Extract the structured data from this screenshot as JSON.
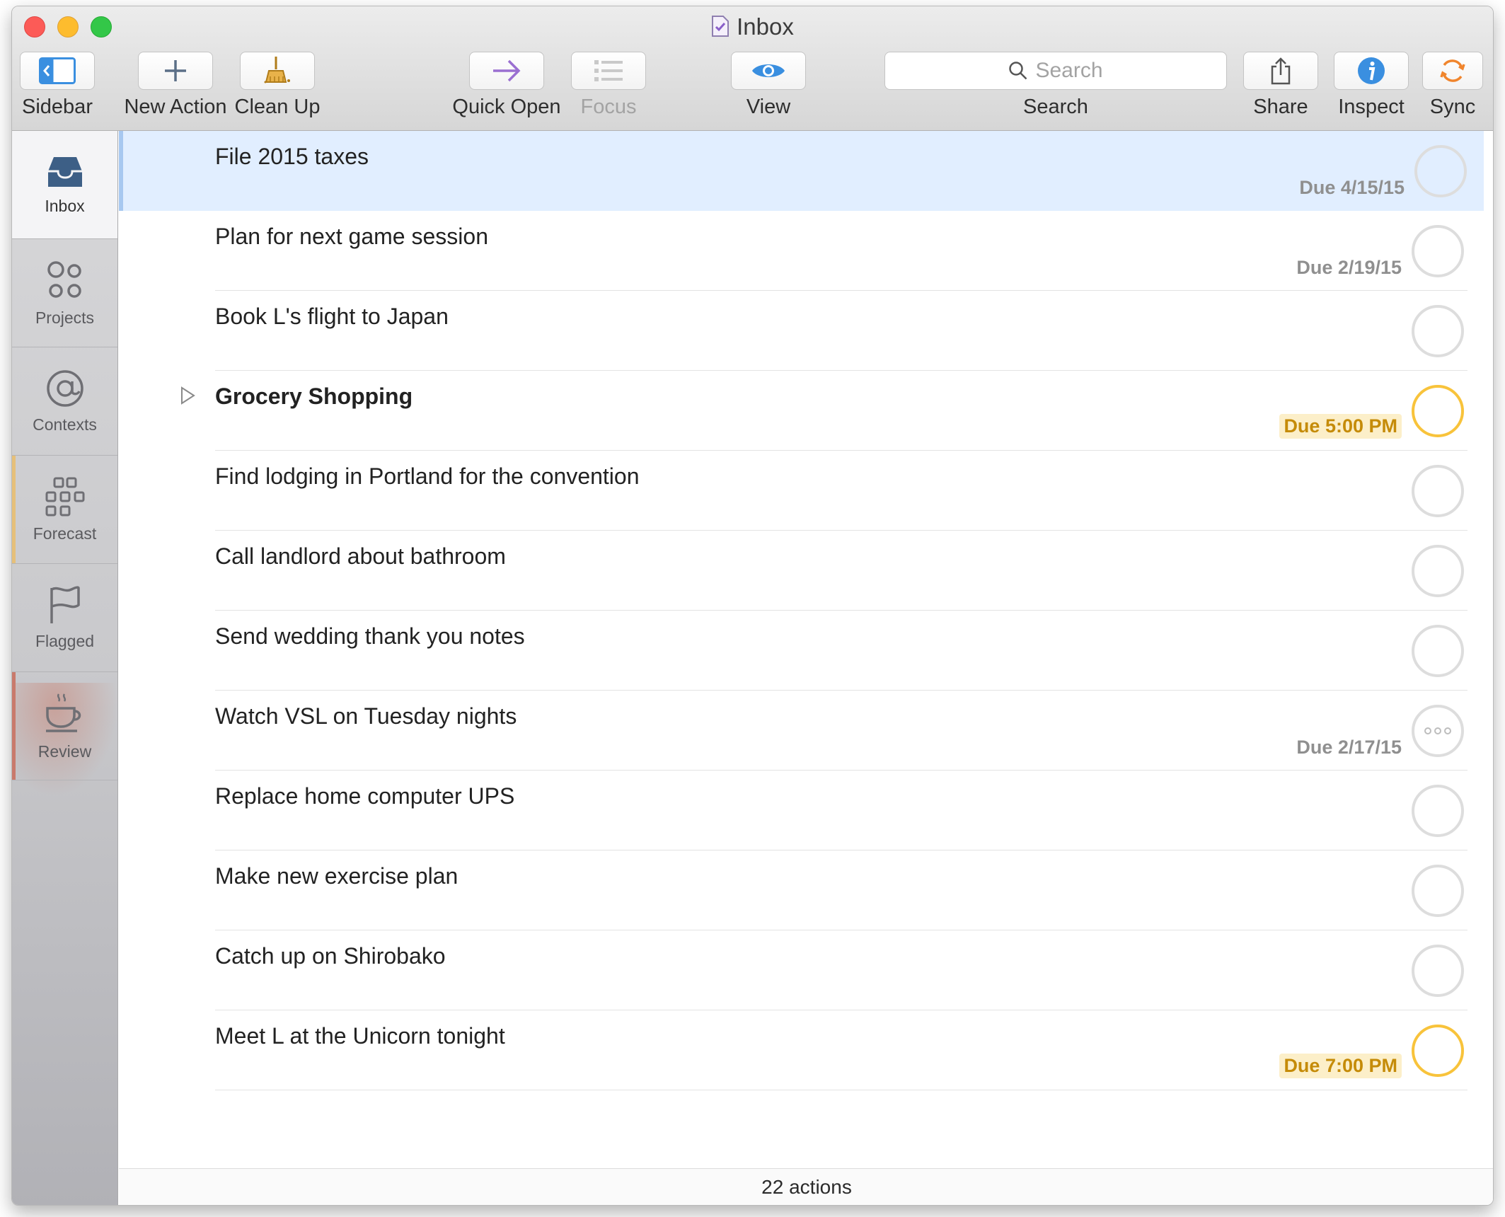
{
  "window": {
    "title": "Inbox"
  },
  "toolbar": {
    "sidebar": "Sidebar",
    "new_action": "New Action",
    "clean_up": "Clean Up",
    "quick_open": "Quick Open",
    "focus": "Focus",
    "view": "View",
    "search_placeholder": "Search",
    "search_label": "Search",
    "share": "Share",
    "inspect": "Inspect",
    "sync": "Sync"
  },
  "sidebar": {
    "tabs": [
      {
        "label": "Inbox",
        "icon": "inbox-tray-icon",
        "active": true
      },
      {
        "label": "Projects",
        "icon": "projects-circles-icon"
      },
      {
        "label": "Contexts",
        "icon": "at-sign-icon"
      },
      {
        "label": "Forecast",
        "icon": "forecast-grid-icon",
        "accent": "#e6c07a"
      },
      {
        "label": "Flagged",
        "icon": "flag-icon"
      },
      {
        "label": "Review",
        "icon": "coffee-cup-icon",
        "accent": "#c97a6c"
      }
    ]
  },
  "actions": [
    {
      "title": "File 2015 taxes",
      "due": "Due 4/15/15",
      "selected": true
    },
    {
      "title": "Plan for next game session",
      "due": "Due 2/19/15"
    },
    {
      "title": "Book L's flight to Japan",
      "due": ""
    },
    {
      "title": "Grocery Shopping",
      "due": "Due 5:00 PM",
      "due_soon": true,
      "group": true
    },
    {
      "title": "Find lodging in Portland for the convention",
      "due": ""
    },
    {
      "title": "Call landlord about bathroom",
      "due": ""
    },
    {
      "title": "Send wedding thank you notes",
      "due": ""
    },
    {
      "title": "Watch VSL on Tuesday nights",
      "due": "Due 2/17/15",
      "repeating": true
    },
    {
      "title": "Replace home computer UPS",
      "due": ""
    },
    {
      "title": "Make new exercise plan",
      "due": ""
    },
    {
      "title": "Catch up on Shirobako",
      "due": ""
    },
    {
      "title": "Meet L at the Unicorn tonight",
      "due": "Due 7:00 PM",
      "due_soon": true
    }
  ],
  "colors": {
    "accent_blue": "#3a8fe0",
    "due_soon": "#f8c33b",
    "selection": "#e1eeff"
  },
  "status": {
    "count": "22 actions"
  }
}
